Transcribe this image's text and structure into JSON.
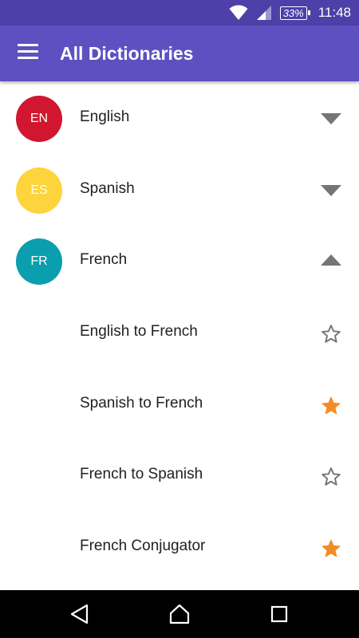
{
  "status_bar": {
    "battery": "33%",
    "time": "11:48",
    "icons": [
      "wifi-icon",
      "cell-signal-icon",
      "battery-icon"
    ]
  },
  "app_bar": {
    "title": "All Dictionaries",
    "menu_icon": "hamburger-menu-icon",
    "color": "#5f50c1"
  },
  "languages": [
    {
      "code": "EN",
      "label": "English",
      "color": "#d0172f",
      "expanded": false
    },
    {
      "code": "ES",
      "label": "Spanish",
      "color": "#fdd43c",
      "expanded": false
    },
    {
      "code": "FR",
      "label": "French",
      "color": "#0b9eae",
      "expanded": true
    }
  ],
  "french_dictionaries": [
    {
      "label": "English to French",
      "favorite": false
    },
    {
      "label": "Spanish to French",
      "favorite": true
    },
    {
      "label": "French to Spanish",
      "favorite": false
    },
    {
      "label": "French Conjugator",
      "favorite": true
    }
  ],
  "colors": {
    "star_favorite": "#f28c28",
    "star_empty": "#757575"
  },
  "nav_bar": {
    "icons": [
      "back-icon",
      "home-icon",
      "recents-icon"
    ]
  }
}
